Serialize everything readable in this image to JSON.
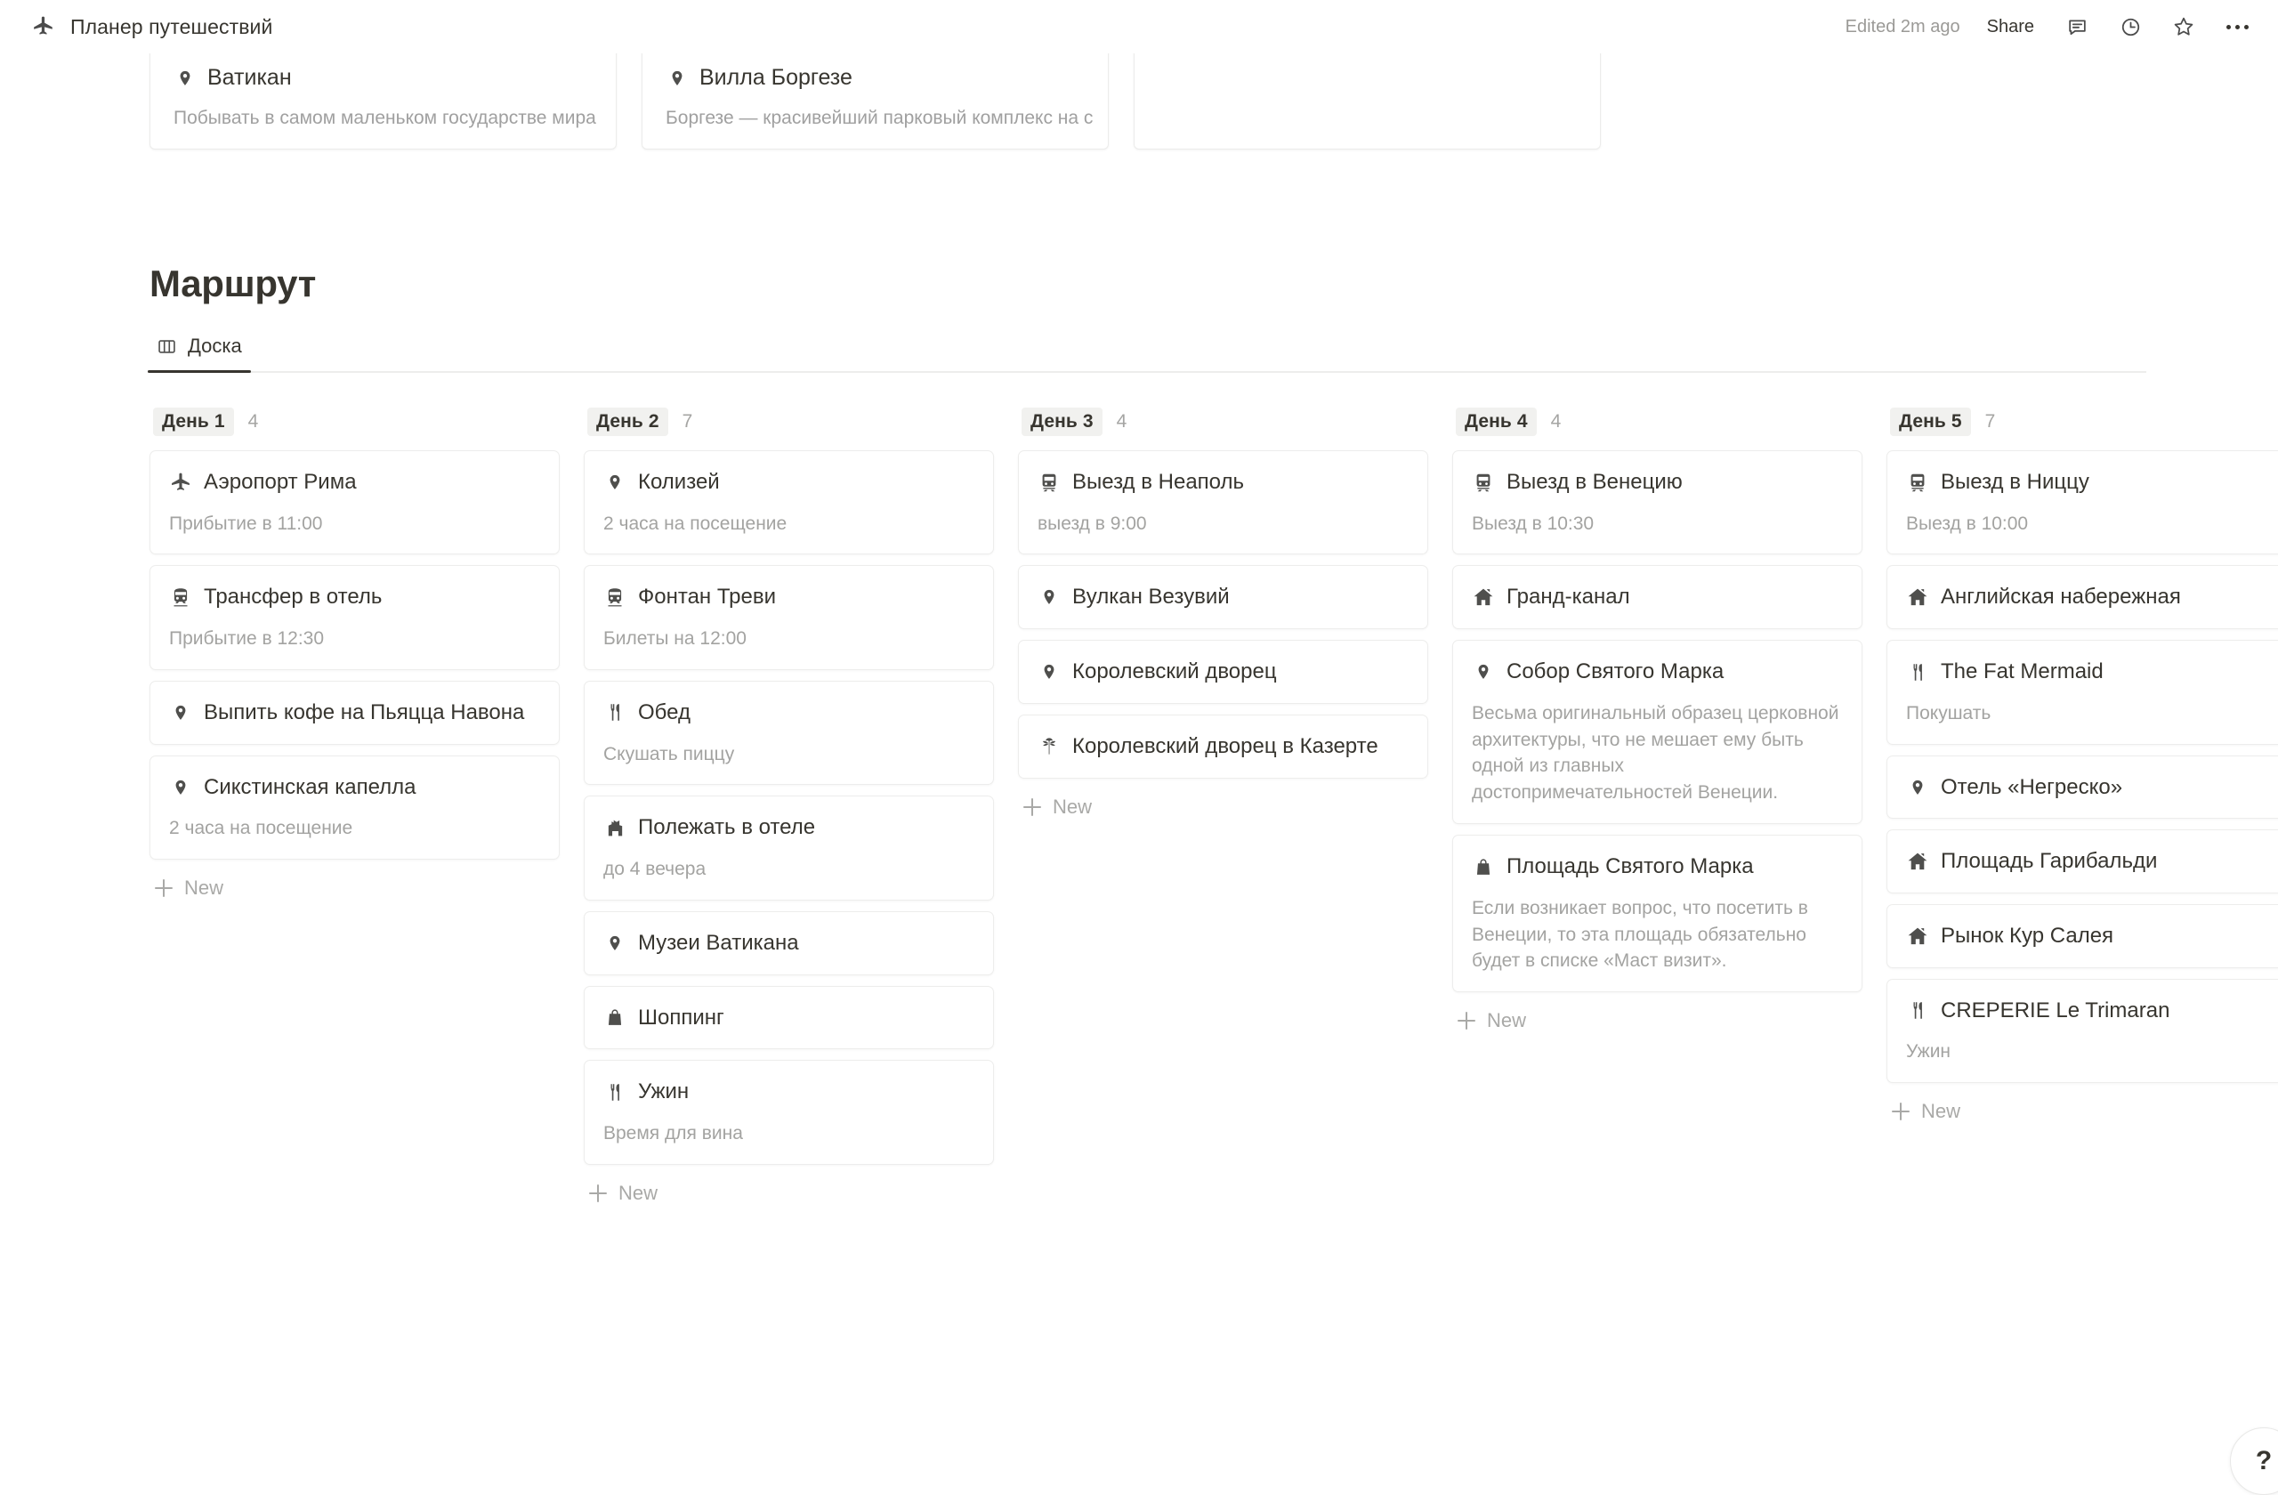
{
  "topbar": {
    "doc_icon": "airplane-icon",
    "title": "Планер путешествий",
    "edited": "Edited 2m ago",
    "share_label": "Share",
    "comment_icon": "comment-icon",
    "history_icon": "clock-icon",
    "favorite_icon": "star-icon",
    "more_icon": "more-options-icon"
  },
  "gallery": {
    "cards": [
      {
        "icon": "pin-icon",
        "title": "Ватикан",
        "desc": "Побывать в самом маленьком государстве мира"
      },
      {
        "icon": "pin-icon",
        "title": "Вилла Боргезе",
        "desc": "Боргезе — красивейший парковый комплекс на с"
      },
      {
        "icon": "",
        "title": "",
        "desc": ""
      }
    ]
  },
  "section": {
    "title": "Маршрут",
    "tabs": [
      {
        "label": "Доска",
        "icon": "board-view-icon",
        "active": true
      }
    ]
  },
  "board": {
    "new_label": "New",
    "columns": [
      {
        "name": "День 1",
        "count": "4",
        "cards": [
          {
            "icon": "airplane-icon",
            "title": "Аэропорт Рима",
            "sub": "Прибытие в 11:00"
          },
          {
            "icon": "tram-icon",
            "title": "Трансфер в отель",
            "sub": "Прибытие в 12:30"
          },
          {
            "icon": "pin-icon",
            "title": "Выпить кофе на Пьяцца Навона",
            "sub": ""
          },
          {
            "icon": "pin-icon",
            "title": "Сикстинская капелла",
            "sub": "2 часа на посещение"
          }
        ]
      },
      {
        "name": "День 2",
        "count": "7",
        "cards": [
          {
            "icon": "pin-icon",
            "title": "Колизей",
            "sub": "2 часа на посещение"
          },
          {
            "icon": "tram-icon",
            "title": "Фонтан Треви",
            "sub": "Билеты на 12:00"
          },
          {
            "icon": "cutlery-icon",
            "title": "Обед",
            "sub": "Скушать пиццу"
          },
          {
            "icon": "building-icon",
            "title": "Полежать в отеле",
            "sub": "до 4 вечера"
          },
          {
            "icon": "pin-icon",
            "title": "Музеи Ватикана",
            "sub": ""
          },
          {
            "icon": "shopping-bag-icon",
            "title": "Шоппинг",
            "sub": ""
          },
          {
            "icon": "cutlery-icon",
            "title": "Ужин",
            "sub": "Время для вина"
          }
        ]
      },
      {
        "name": "День 3",
        "count": "4",
        "cards": [
          {
            "icon": "train-icon",
            "title": "Выезд в Неаполь",
            "sub": "выезд в 9:00"
          },
          {
            "icon": "pin-icon",
            "title": "Вулкан Везувий",
            "sub": ""
          },
          {
            "icon": "pin-icon",
            "title": "Королевский дворец",
            "sub": ""
          },
          {
            "icon": "palm-tree-icon",
            "title": "Королевский дворец в Казерте",
            "sub": ""
          }
        ]
      },
      {
        "name": "День 4",
        "count": "4",
        "cards": [
          {
            "icon": "train-icon",
            "title": "Выезд в Венецию",
            "sub": "Выезд в 10:30"
          },
          {
            "icon": "home-icon",
            "title": "Гранд-канал",
            "sub": ""
          },
          {
            "icon": "pin-icon",
            "title": "Собор Святого Марка",
            "sub": "Весьма оригинальный образец церковной архитектуры, что не мешает ему быть одной из главных достопримечательностей Венеции."
          },
          {
            "icon": "shopping-bag-icon",
            "title": "Площадь Святого Марка",
            "sub": "Если возникает вопрос, что посетить в Венеции, то эта площадь обязательно будет в списке «Маст визит»."
          }
        ]
      },
      {
        "name": "День 5",
        "count": "7",
        "cards": [
          {
            "icon": "train-icon",
            "title": "Выезд в Ниццу",
            "sub": "Выезд в 10:00"
          },
          {
            "icon": "home-icon",
            "title": "Английская набережная",
            "sub": ""
          },
          {
            "icon": "cutlery-icon",
            "title": "The Fat Mermaid",
            "sub": "Покушать"
          },
          {
            "icon": "pin-icon",
            "title": "Отель «Негреско»",
            "sub": ""
          },
          {
            "icon": "home-icon",
            "title": "Площадь Гарибальди",
            "sub": ""
          },
          {
            "icon": "home-icon",
            "title": "Рынок Кур Салея",
            "sub": ""
          },
          {
            "icon": "cutlery-icon",
            "title": "CREPERIE Le Trimaran",
            "sub": "Ужин"
          }
        ]
      }
    ]
  },
  "help": {
    "label": "?"
  },
  "colors": {
    "text": "#37352f",
    "muted": "#a3a3a1",
    "border": "#ededec",
    "chip_bg": "#f1f1ef"
  }
}
